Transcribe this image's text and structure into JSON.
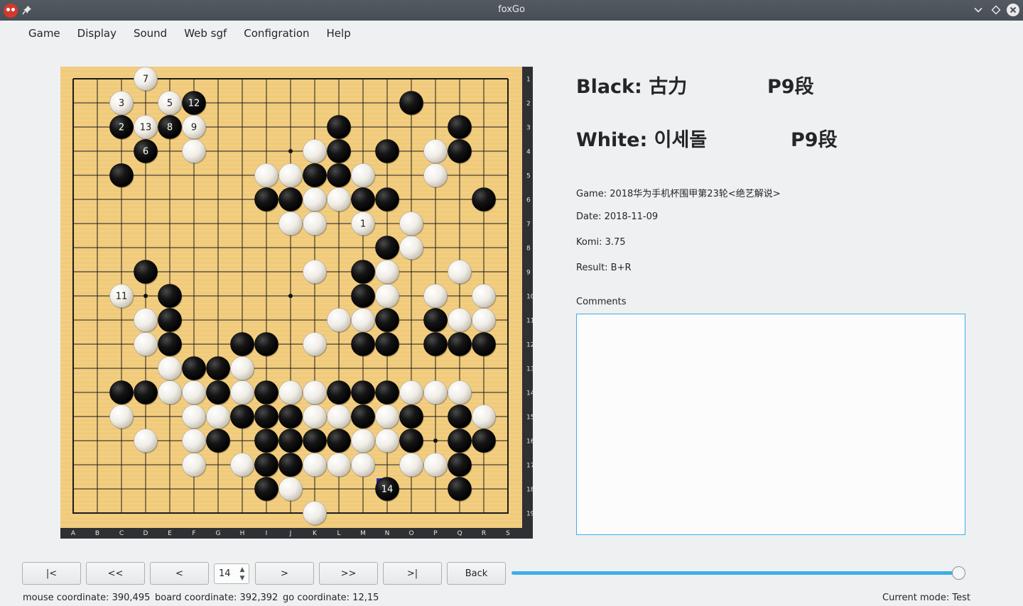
{
  "window": {
    "title": "foxGo",
    "icons": [
      "app-icon",
      "pin-icon",
      "minimize-icon",
      "maximize-icon",
      "close-icon"
    ]
  },
  "menu": [
    "Game",
    "Display",
    "Sound",
    "Web sgf",
    "Configration",
    "Help"
  ],
  "board": {
    "size": 19,
    "col_labels": [
      "A",
      "B",
      "C",
      "D",
      "E",
      "F",
      "G",
      "H",
      "I",
      "J",
      "K",
      "L",
      "M",
      "N",
      "O",
      "P",
      "Q",
      "R",
      "S"
    ],
    "row_labels": [
      "1",
      "2",
      "3",
      "4",
      "5",
      "6",
      "7",
      "8",
      "9",
      "10",
      "11",
      "12",
      "13",
      "14",
      "15",
      "16",
      "17",
      "18",
      "19"
    ],
    "star_points": [
      [
        4,
        4
      ],
      [
        10,
        4
      ],
      [
        16,
        4
      ],
      [
        4,
        10
      ],
      [
        10,
        10
      ],
      [
        16,
        10
      ],
      [
        4,
        16
      ],
      [
        10,
        16
      ],
      [
        16,
        16
      ]
    ],
    "last_move_marker_color": "#1a2bd1",
    "stones": [
      {
        "c": "w",
        "col": 4,
        "row": 1,
        "n": "7"
      },
      {
        "c": "w",
        "col": 3,
        "row": 2,
        "n": "3"
      },
      {
        "c": "w",
        "col": 5,
        "row": 2,
        "n": "5"
      },
      {
        "c": "b",
        "col": 6,
        "row": 2,
        "n": "12"
      },
      {
        "c": "b",
        "col": 15,
        "row": 2
      },
      {
        "c": "b",
        "col": 3,
        "row": 3,
        "n": "2"
      },
      {
        "c": "w",
        "col": 4,
        "row": 3,
        "n": "13"
      },
      {
        "c": "b",
        "col": 5,
        "row": 3,
        "n": "8"
      },
      {
        "c": "w",
        "col": 6,
        "row": 3,
        "n": "9"
      },
      {
        "c": "b",
        "col": 12,
        "row": 3
      },
      {
        "c": "b",
        "col": 17,
        "row": 3
      },
      {
        "c": "b",
        "col": 4,
        "row": 4,
        "n": "6"
      },
      {
        "c": "w",
        "col": 6,
        "row": 4
      },
      {
        "c": "w",
        "col": 11,
        "row": 4
      },
      {
        "c": "b",
        "col": 12,
        "row": 4
      },
      {
        "c": "b",
        "col": 14,
        "row": 4
      },
      {
        "c": "w",
        "col": 16,
        "row": 4
      },
      {
        "c": "b",
        "col": 17,
        "row": 4
      },
      {
        "c": "b",
        "col": 3,
        "row": 5
      },
      {
        "c": "w",
        "col": 9,
        "row": 5
      },
      {
        "c": "w",
        "col": 10,
        "row": 5
      },
      {
        "c": "b",
        "col": 11,
        "row": 5
      },
      {
        "c": "b",
        "col": 12,
        "row": 5
      },
      {
        "c": "w",
        "col": 13,
        "row": 5
      },
      {
        "c": "w",
        "col": 16,
        "row": 5
      },
      {
        "c": "b",
        "col": 9,
        "row": 6
      },
      {
        "c": "b",
        "col": 10,
        "row": 6
      },
      {
        "c": "w",
        "col": 11,
        "row": 6
      },
      {
        "c": "w",
        "col": 12,
        "row": 6
      },
      {
        "c": "b",
        "col": 13,
        "row": 6
      },
      {
        "c": "b",
        "col": 14,
        "row": 6
      },
      {
        "c": "b",
        "col": 18,
        "row": 6
      },
      {
        "c": "w",
        "col": 10,
        "row": 7
      },
      {
        "c": "w",
        "col": 11,
        "row": 7
      },
      {
        "c": "w",
        "col": 13,
        "row": 7,
        "n": "1"
      },
      {
        "c": "w",
        "col": 15,
        "row": 7
      },
      {
        "c": "b",
        "col": 14,
        "row": 8
      },
      {
        "c": "w",
        "col": 15,
        "row": 8
      },
      {
        "c": "b",
        "col": 4,
        "row": 9
      },
      {
        "c": "w",
        "col": 11,
        "row": 9
      },
      {
        "c": "b",
        "col": 13,
        "row": 9
      },
      {
        "c": "w",
        "col": 14,
        "row": 9
      },
      {
        "c": "w",
        "col": 17,
        "row": 9
      },
      {
        "c": "w",
        "col": 3,
        "row": 10,
        "n": "11"
      },
      {
        "c": "b",
        "col": 5,
        "row": 10
      },
      {
        "c": "b",
        "col": 13,
        "row": 10
      },
      {
        "c": "w",
        "col": 14,
        "row": 10
      },
      {
        "c": "w",
        "col": 16,
        "row": 10
      },
      {
        "c": "w",
        "col": 18,
        "row": 10
      },
      {
        "c": "w",
        "col": 4,
        "row": 11
      },
      {
        "c": "b",
        "col": 5,
        "row": 11
      },
      {
        "c": "w",
        "col": 12,
        "row": 11
      },
      {
        "c": "w",
        "col": 13,
        "row": 11
      },
      {
        "c": "b",
        "col": 14,
        "row": 11
      },
      {
        "c": "b",
        "col": 16,
        "row": 11
      },
      {
        "c": "w",
        "col": 17,
        "row": 11
      },
      {
        "c": "w",
        "col": 18,
        "row": 11
      },
      {
        "c": "w",
        "col": 4,
        "row": 12
      },
      {
        "c": "b",
        "col": 5,
        "row": 12
      },
      {
        "c": "b",
        "col": 8,
        "row": 12
      },
      {
        "c": "b",
        "col": 9,
        "row": 12
      },
      {
        "c": "w",
        "col": 11,
        "row": 12
      },
      {
        "c": "b",
        "col": 13,
        "row": 12
      },
      {
        "c": "b",
        "col": 14,
        "row": 12
      },
      {
        "c": "b",
        "col": 16,
        "row": 12
      },
      {
        "c": "b",
        "col": 17,
        "row": 12
      },
      {
        "c": "b",
        "col": 18,
        "row": 12
      },
      {
        "c": "w",
        "col": 5,
        "row": 13
      },
      {
        "c": "b",
        "col": 6,
        "row": 13
      },
      {
        "c": "b",
        "col": 7,
        "row": 13
      },
      {
        "c": "w",
        "col": 8,
        "row": 13
      },
      {
        "c": "b",
        "col": 3,
        "row": 14
      },
      {
        "c": "b",
        "col": 4,
        "row": 14
      },
      {
        "c": "w",
        "col": 5,
        "row": 14
      },
      {
        "c": "w",
        "col": 6,
        "row": 14
      },
      {
        "c": "b",
        "col": 7,
        "row": 14
      },
      {
        "c": "w",
        "col": 8,
        "row": 14
      },
      {
        "c": "b",
        "col": 9,
        "row": 14
      },
      {
        "c": "w",
        "col": 10,
        "row": 14
      },
      {
        "c": "w",
        "col": 11,
        "row": 14
      },
      {
        "c": "b",
        "col": 12,
        "row": 14
      },
      {
        "c": "b",
        "col": 13,
        "row": 14
      },
      {
        "c": "b",
        "col": 14,
        "row": 14
      },
      {
        "c": "w",
        "col": 15,
        "row": 14
      },
      {
        "c": "w",
        "col": 16,
        "row": 14
      },
      {
        "c": "w",
        "col": 17,
        "row": 14
      },
      {
        "c": "w",
        "col": 3,
        "row": 15
      },
      {
        "c": "w",
        "col": 6,
        "row": 15
      },
      {
        "c": "w",
        "col": 7,
        "row": 15
      },
      {
        "c": "b",
        "col": 8,
        "row": 15
      },
      {
        "c": "b",
        "col": 9,
        "row": 15
      },
      {
        "c": "b",
        "col": 10,
        "row": 15
      },
      {
        "c": "w",
        "col": 11,
        "row": 15
      },
      {
        "c": "w",
        "col": 12,
        "row": 15
      },
      {
        "c": "b",
        "col": 13,
        "row": 15
      },
      {
        "c": "w",
        "col": 14,
        "row": 15
      },
      {
        "c": "b",
        "col": 15,
        "row": 15
      },
      {
        "c": "b",
        "col": 17,
        "row": 15
      },
      {
        "c": "w",
        "col": 18,
        "row": 15
      },
      {
        "c": "w",
        "col": 4,
        "row": 16
      },
      {
        "c": "w",
        "col": 6,
        "row": 16
      },
      {
        "c": "b",
        "col": 7,
        "row": 16
      },
      {
        "c": "b",
        "col": 9,
        "row": 16
      },
      {
        "c": "b",
        "col": 10,
        "row": 16
      },
      {
        "c": "b",
        "col": 11,
        "row": 16
      },
      {
        "c": "b",
        "col": 12,
        "row": 16
      },
      {
        "c": "w",
        "col": 13,
        "row": 16
      },
      {
        "c": "w",
        "col": 14,
        "row": 16
      },
      {
        "c": "b",
        "col": 15,
        "row": 16
      },
      {
        "c": "b",
        "col": 17,
        "row": 16
      },
      {
        "c": "b",
        "col": 18,
        "row": 16
      },
      {
        "c": "w",
        "col": 6,
        "row": 17
      },
      {
        "c": "w",
        "col": 8,
        "row": 17
      },
      {
        "c": "b",
        "col": 9,
        "row": 17
      },
      {
        "c": "b",
        "col": 10,
        "row": 17
      },
      {
        "c": "w",
        "col": 11,
        "row": 17
      },
      {
        "c": "w",
        "col": 12,
        "row": 17
      },
      {
        "c": "w",
        "col": 13,
        "row": 17
      },
      {
        "c": "w",
        "col": 15,
        "row": 17
      },
      {
        "c": "w",
        "col": 16,
        "row": 17
      },
      {
        "c": "b",
        "col": 17,
        "row": 17
      },
      {
        "c": "b",
        "col": 9,
        "row": 18
      },
      {
        "c": "w",
        "col": 10,
        "row": 18
      },
      {
        "c": "b",
        "col": 14,
        "row": 18,
        "n": "14",
        "last": true
      },
      {
        "c": "b",
        "col": 17,
        "row": 18
      },
      {
        "c": "w",
        "col": 11,
        "row": 19
      }
    ]
  },
  "info": {
    "black_label": "Black: 古力",
    "black_rank": "P9段",
    "white_label": "White: 이세돌",
    "white_rank": "P9段",
    "game": "Game: 2018华为手机杯围甲第23轮<绝艺解说>",
    "date": "Date: 2018-11-09",
    "komi": "Komi: 3.75",
    "result": "Result: B+R",
    "comments_label": "Comments",
    "comments_value": ""
  },
  "nav": {
    "first": "|<",
    "back_many": "<<",
    "prev": "<",
    "move_number": "14",
    "next": ">",
    "forward_many": ">>",
    "last": ">|",
    "back": "Back",
    "slider_progress": 1.0
  },
  "status": {
    "mouse": "mouse coordinate: 390,495",
    "board": "board coordinate: 392,392",
    "go": "go coordinate: 12,15",
    "mode": "Current mode: Test"
  }
}
